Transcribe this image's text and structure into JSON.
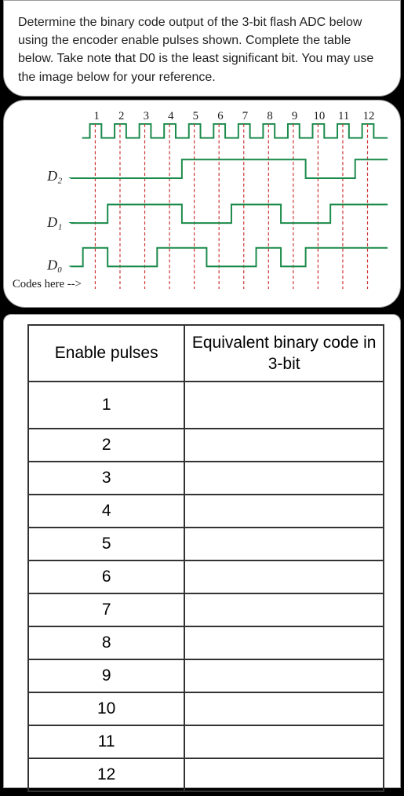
{
  "question": "Determine the binary code output of the 3-bit flash ADC below using the encoder enable pulses shown. Complete the table below. Take note that D0 is the least significant bit. You may use the image below for your reference.",
  "diagram": {
    "axis_numbers": [
      "1",
      "2",
      "3",
      "4",
      "5",
      "6",
      "7",
      "8",
      "9",
      "10",
      "11",
      "12"
    ],
    "signals": [
      "D₂",
      "D₁",
      "D₀"
    ],
    "codes_label": "Codes here -->"
  },
  "table": {
    "header_left": "Enable pulses",
    "header_right": "Equivalent binary code in 3-bit",
    "rows": [
      {
        "pulse": "1",
        "code": ""
      },
      {
        "pulse": "2",
        "code": ""
      },
      {
        "pulse": "3",
        "code": ""
      },
      {
        "pulse": "4",
        "code": ""
      },
      {
        "pulse": "5",
        "code": ""
      },
      {
        "pulse": "6",
        "code": ""
      },
      {
        "pulse": "7",
        "code": ""
      },
      {
        "pulse": "8",
        "code": ""
      },
      {
        "pulse": "9",
        "code": ""
      },
      {
        "pulse": "10",
        "code": ""
      },
      {
        "pulse": "11",
        "code": ""
      },
      {
        "pulse": "12",
        "code": ""
      }
    ]
  },
  "chart_data": {
    "type": "timing-diagram",
    "pulses": 12,
    "signals": {
      "D2": [
        0,
        0,
        0,
        0,
        1,
        1,
        1,
        1,
        1,
        0,
        0,
        1
      ],
      "D1": [
        0,
        1,
        1,
        1,
        0,
        0,
        1,
        1,
        0,
        0,
        1,
        1
      ],
      "D0": [
        1,
        0,
        0,
        1,
        1,
        0,
        0,
        1,
        0,
        1,
        1,
        1
      ]
    }
  }
}
